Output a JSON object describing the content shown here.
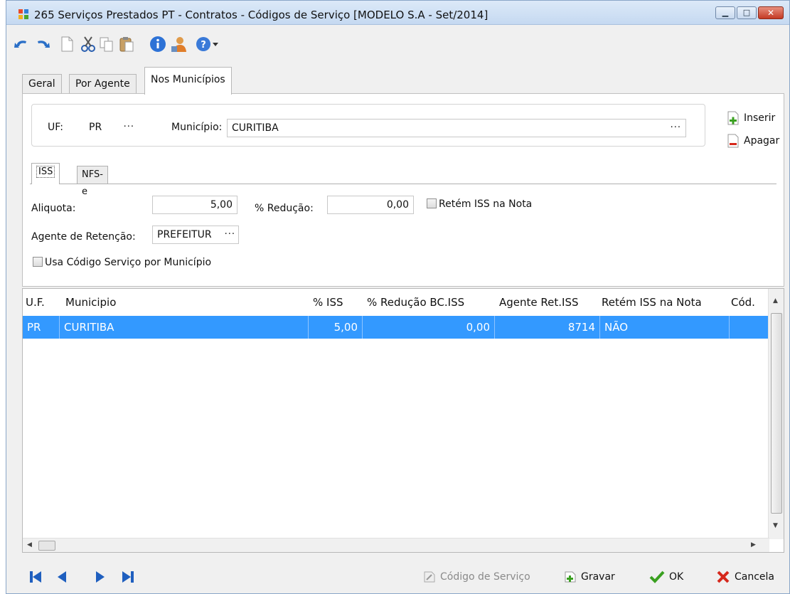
{
  "window": {
    "title": "265 Serviços Prestados PT - Contratos -  Códigos de Serviço [MODELO S.A - Set/2014]",
    "controls": [
      "minimize",
      "maximize",
      "close"
    ]
  },
  "toolbar": {
    "items": [
      "undo-icon",
      "redo-icon",
      "new-icon",
      "cut-icon",
      "copy-icon",
      "paste-icon",
      "info-icon",
      "user-icon",
      "help-icon"
    ]
  },
  "tabs": {
    "geral": "Geral",
    "por_agente": "Por Agente",
    "nos_municipios": "Nos Municípios"
  },
  "location": {
    "uf_label": "UF:",
    "uf_value": "PR",
    "municipio_label": "Município:",
    "municipio_value": "CURITIBA",
    "ellipsis": "···"
  },
  "side_actions": {
    "inserir": "Inserir",
    "apagar": "Apagar"
  },
  "subtabs": {
    "iss": "ISS",
    "nfse": "NFS-e"
  },
  "iss": {
    "aliquota_label": "Aliquota:",
    "aliquota_value": "5,00",
    "reducao_label": "% Redução:",
    "reducao_value": "0,00",
    "retem_label": "Retém ISS na Nota",
    "agente_label": "Agente de Retenção:",
    "agente_value": "PREFEITUR",
    "usa_codigo_label": "Usa Código Serviço por Município"
  },
  "grid": {
    "columns": [
      "U.F.",
      "Municipio",
      "% ISS",
      "% Redução BC.ISS",
      "Agente Ret.ISS",
      "Retém ISS na Nota",
      "Cód."
    ],
    "rows": [
      [
        "PR",
        "CURITIBA",
        "5,00",
        "0,00",
        "8714",
        "NÃO",
        ""
      ]
    ]
  },
  "nav": [
    "first-icon",
    "prev-icon",
    "next-icon",
    "last-icon"
  ],
  "footer": {
    "codigo_servico": "Código de Serviço",
    "gravar": "Gravar",
    "ok": "OK",
    "cancela": "Cancela"
  },
  "colors": {
    "selection": "#3399ff",
    "ok_green": "#3aa020",
    "cancel_red": "#d6281c",
    "nav_blue": "#1f5fbf"
  }
}
